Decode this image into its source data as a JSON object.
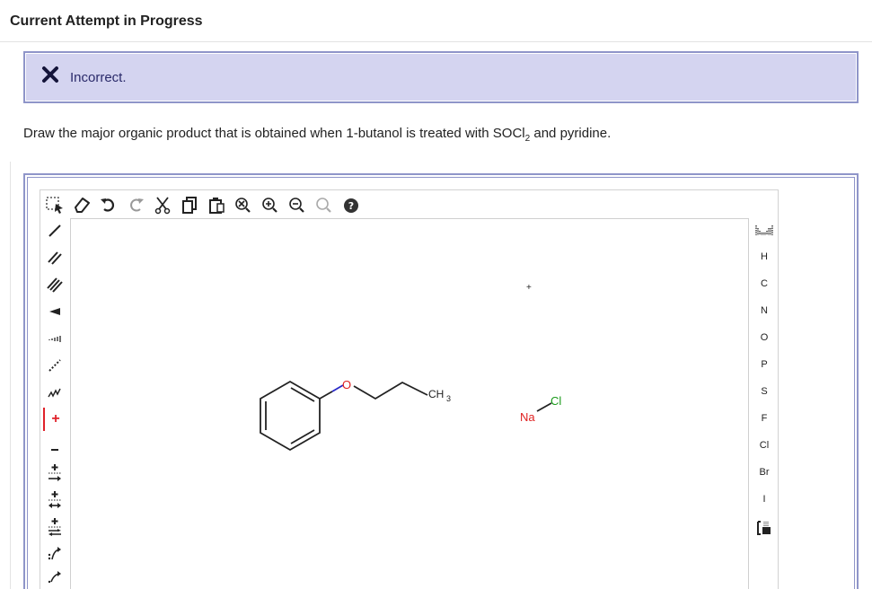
{
  "header": {
    "title": "Current Attempt in Progress"
  },
  "feedback": {
    "status": "Incorrect.",
    "icon": "close-icon"
  },
  "question": {
    "text_before": "Draw the major organic product that is obtained when 1-butanol is treated with SOCl",
    "subscript": "2",
    "text_after": " and pyridine."
  },
  "top_toolbar": [
    "selection-tool-icon",
    "eraser-icon",
    "undo-icon",
    "redo-icon",
    "cut-icon",
    "copy-icon",
    "paste-icon",
    "clear-icon",
    "zoom-in-icon",
    "zoom-out-icon",
    "zoom-fit-icon",
    "help-icon"
  ],
  "left_toolbar": [
    "single-bond-icon",
    "double-bond-icon",
    "triple-bond-icon",
    "wedge-bond-icon",
    "hash-bond-icon",
    "dashed-bond-icon",
    "wavy-bond-icon",
    "positive-charge-icon",
    "negative-charge-icon",
    "electron-arrow-right-icon",
    "electron-arrow-double-icon",
    "electron-arrow-both-icon",
    "electron-pair-arrow-icon",
    "curved-arrow-icon"
  ],
  "periodic_table_icon": "periodic-table-icon",
  "elements": [
    "H",
    "C",
    "N",
    "O",
    "P",
    "S",
    "F",
    "Cl",
    "Br",
    "I"
  ],
  "templates_icon": "templates-icon",
  "canvas": {
    "oxygen_label": "O",
    "methyl_label": "CH",
    "methyl_sub": "3",
    "plus_sign": "+",
    "sodium_label": "Na",
    "chlorine_label": "Cl"
  },
  "colors": {
    "accent_red": "#e0222a",
    "feedback_bg": "#d4d4f0",
    "frame_border": "#8f95c9",
    "oxygen_red": "#e02020",
    "chlorine_green": "#1a9a1a"
  }
}
